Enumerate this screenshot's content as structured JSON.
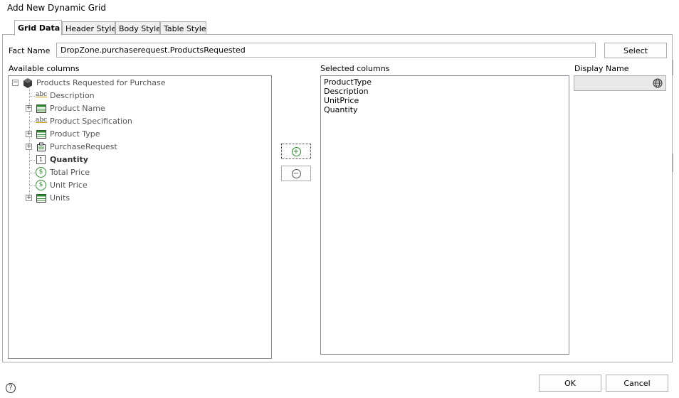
{
  "window": {
    "title": "Add New Dynamic Grid"
  },
  "tabs": [
    {
      "label": "Grid Data",
      "active": true
    },
    {
      "label": "Header Style",
      "active": false
    },
    {
      "label": "Body Style",
      "active": false
    },
    {
      "label": "Table Style",
      "active": false
    }
  ],
  "fact": {
    "label": "Fact Name",
    "value": "DropZone.purchaserequest.ProductsRequested",
    "select_label": "Select"
  },
  "available": {
    "label": "Available columns",
    "root": "Products Requested for Purchase",
    "items": [
      {
        "label": "Description",
        "icon": "text-field-icon",
        "expandable": false,
        "bold": false
      },
      {
        "label": "Product Name",
        "icon": "table-entity-icon",
        "expandable": true,
        "bold": false
      },
      {
        "label": "Product Specification",
        "icon": "text-field-icon",
        "expandable": false,
        "bold": false
      },
      {
        "label": "Product Type",
        "icon": "table-entity-icon",
        "expandable": true,
        "bold": false
      },
      {
        "label": "PurchaseRequest",
        "icon": "form-entity-icon",
        "expandable": true,
        "bold": false
      },
      {
        "label": "Quantity",
        "icon": "number-field-icon",
        "expandable": false,
        "bold": true
      },
      {
        "label": "Total Price",
        "icon": "currency-field-icon",
        "expandable": false,
        "bold": false
      },
      {
        "label": "Unit Price",
        "icon": "currency-field-icon",
        "expandable": false,
        "bold": false
      },
      {
        "label": "Units",
        "icon": "table-entity-icon",
        "expandable": true,
        "bold": false
      }
    ]
  },
  "selected": {
    "label": "Selected columns",
    "items": [
      "ProductType",
      "Description",
      "UnitPrice",
      "Quantity"
    ]
  },
  "display": {
    "label": "Display Name",
    "value": ""
  },
  "footer": {
    "ok_label": "OK",
    "cancel_label": "Cancel",
    "help_glyph": "?"
  },
  "icons": {
    "abc": "abc",
    "number": "1",
    "currency": "$",
    "minus": "−",
    "plus": "+"
  },
  "colors": {
    "accent_green": "#2d8a2d",
    "tree_gray": "#555555",
    "border": "#adadad"
  }
}
